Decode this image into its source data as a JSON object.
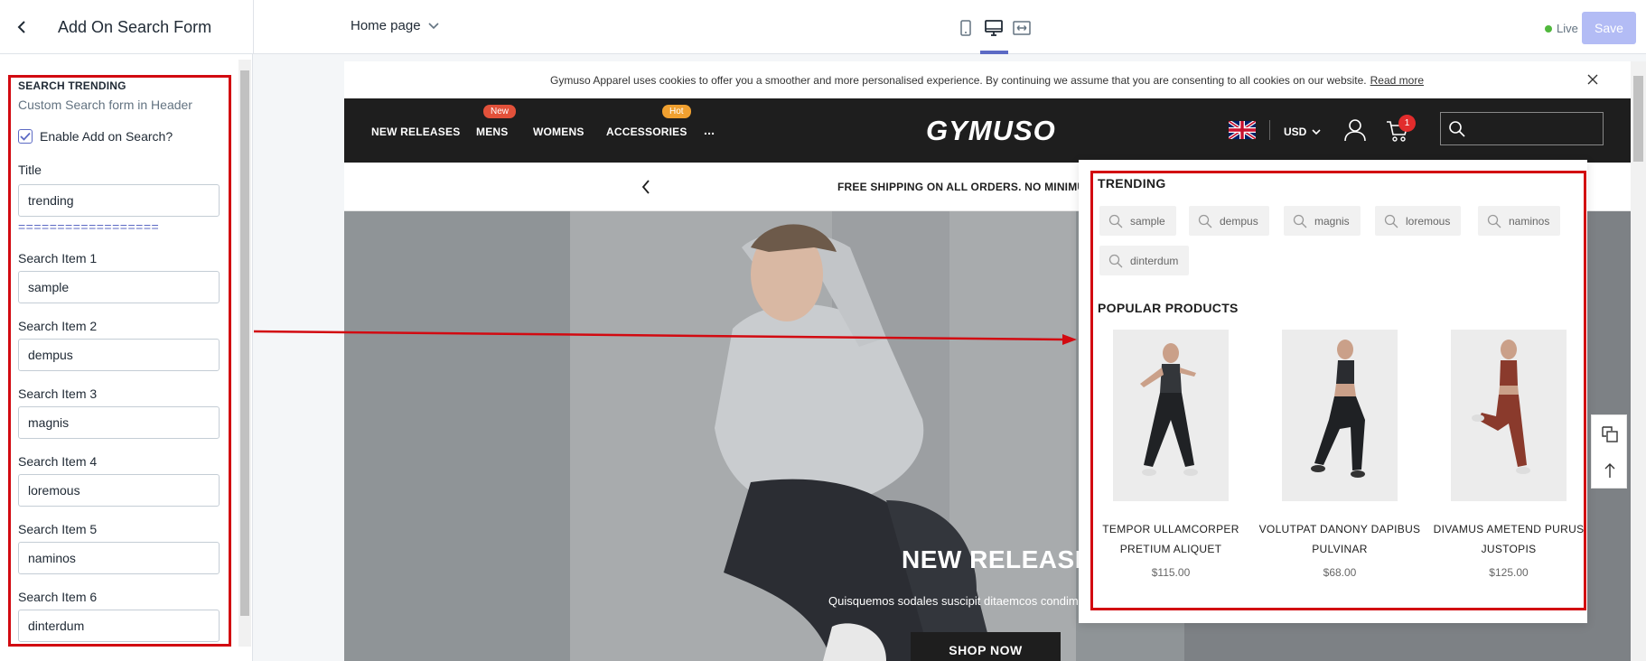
{
  "editor": {
    "title": "Add On Search Form",
    "page_selector": "Home page",
    "status": "Live",
    "save_label": "Save"
  },
  "sidebar": {
    "section_heading": "SEARCH TRENDING",
    "section_description": "Custom Search form in Header",
    "enable_label": "Enable Add on Search?",
    "enable_checked": true,
    "title_label": "Title",
    "title_value": "trending",
    "separator": "==================",
    "items": [
      {
        "label": "Search Item 1",
        "value": "sample"
      },
      {
        "label": "Search Item 2",
        "value": "dempus"
      },
      {
        "label": "Search Item 3",
        "value": "magnis"
      },
      {
        "label": "Search Item 4",
        "value": "loremous"
      },
      {
        "label": "Search Item 5",
        "value": "naminos"
      },
      {
        "label": "Search Item 6",
        "value": "dinterdum"
      }
    ]
  },
  "site": {
    "cookie_text": "Gymuso Apparel uses cookies to offer you a smoother and more personalised experience. By continuing we assume that you are consenting to all cookies on our website.",
    "cookie_link": "Read more",
    "nav": [
      {
        "label": "NEW RELEASES"
      },
      {
        "label": "MENS",
        "badge": "New",
        "badge_color": "#e2513a"
      },
      {
        "label": "WOMENS"
      },
      {
        "label": "ACCESSORIES",
        "badge": "Hot",
        "badge_color": "#f0a030"
      },
      {
        "label": "..."
      }
    ],
    "logo": "GYMUSO",
    "currency": "USD",
    "cart_count": "1",
    "shipping_text": "FREE SHIPPING ON ALL ORDERS. NO MINIMUM PU",
    "hero": {
      "heading": "NEW RELEASES",
      "subtext": "Quisquemos sodales suscipit ditaemcos condimentu",
      "button": "SHOP NOW"
    }
  },
  "dropdown": {
    "trending_heading": "TRENDING",
    "tags": [
      "sample",
      "dempus",
      "magnis",
      "loremous",
      "naminos",
      "dinterdum"
    ],
    "popular_heading": "POPULAR PRODUCTS",
    "products": [
      {
        "name_line1": "TEMPOR ULLAMCORPER",
        "name_line2": "PRETIUM ALIQUET",
        "price": "$115.00"
      },
      {
        "name_line1": "VOLUTPAT DANONY DAPIBUS",
        "name_line2": "PULVINAR",
        "price": "$68.00"
      },
      {
        "name_line1": "DIVAMUS AMETEND PURUS",
        "name_line2": "JUSTOPIS",
        "price": "$125.00"
      }
    ]
  },
  "colors": {
    "accent": "#5c6ac4",
    "annotation_red": "#d20a11",
    "save_disabled": "#b3bcf5",
    "header_dark": "#1e1e1e"
  }
}
